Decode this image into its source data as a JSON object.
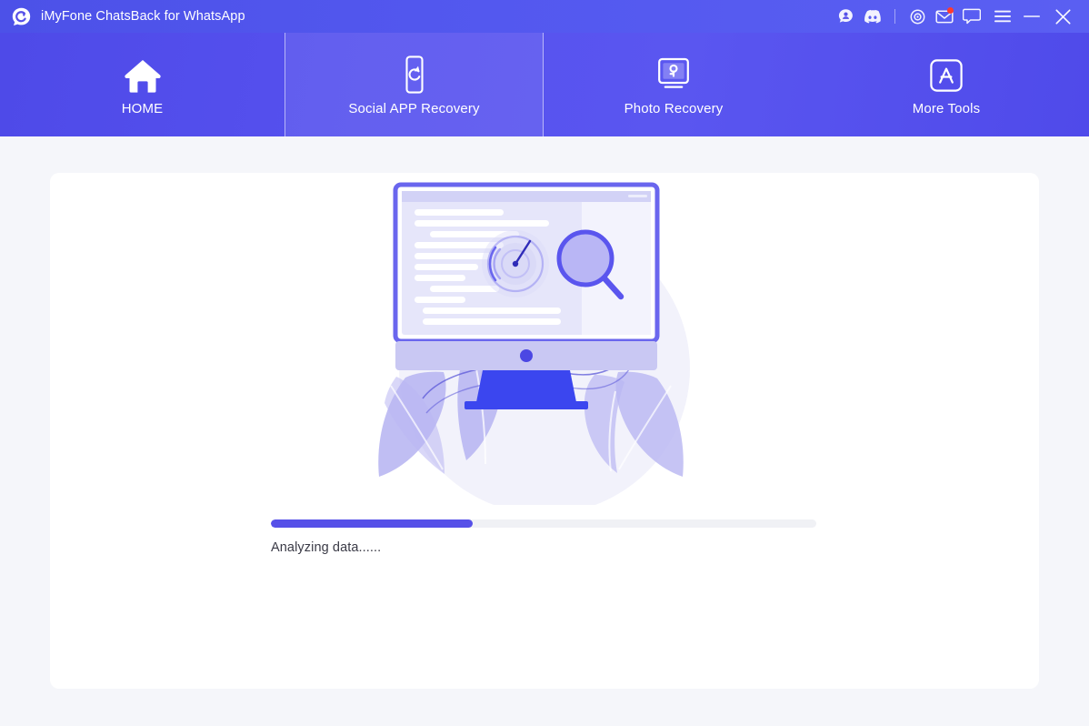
{
  "window": {
    "title": "iMyFone ChatsBack for WhatsApp",
    "logo_icon": "chatsback-logo-icon"
  },
  "titlebar_actions": [
    {
      "name": "support-avatar-icon",
      "label": "Support"
    },
    {
      "name": "discord-icon",
      "label": "Discord"
    },
    {
      "name": "separator",
      "label": ""
    },
    {
      "name": "target-icon",
      "label": "Settings"
    },
    {
      "name": "mail-icon",
      "label": "Messages",
      "badge": true
    },
    {
      "name": "feedback-chat-icon",
      "label": "Feedback"
    },
    {
      "name": "hamburger-menu-icon",
      "label": "Menu"
    },
    {
      "name": "minimize-icon",
      "label": "Minimize"
    },
    {
      "name": "close-icon",
      "label": "Close"
    }
  ],
  "nav": {
    "tabs": [
      {
        "label": "HOME",
        "icon": "home-icon",
        "active": false
      },
      {
        "label": "Social APP Recovery",
        "icon": "phone-refresh-icon",
        "active": true
      },
      {
        "label": "Photo Recovery",
        "icon": "monitor-photo-icon",
        "active": false
      },
      {
        "label": "More Tools",
        "icon": "app-store-icon",
        "active": false
      }
    ]
  },
  "main": {
    "illustration_name": "analyzing-monitor-illustration",
    "progress": {
      "percent": 37,
      "status_text": "Analyzing data......"
    }
  },
  "colors": {
    "brand_purple": "#5650e8",
    "header_gradient_start": "#4e4ae8",
    "header_gradient_end": "#5a56f0",
    "page_background": "#f5f6fa",
    "card_background": "#ffffff",
    "badge_red": "#ff3b30",
    "progress_track": "#f0f1f5",
    "status_text_color": "#3a3a46"
  }
}
